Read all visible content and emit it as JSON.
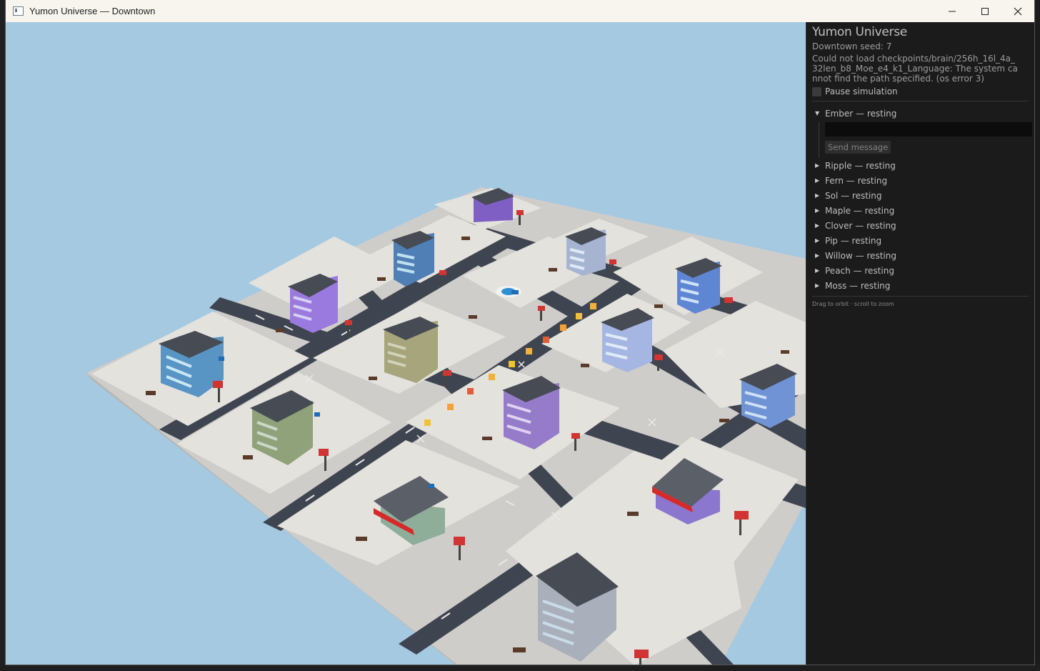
{
  "window": {
    "title": "Yumon Universe — Downtown",
    "controls": {
      "minimize": "—",
      "maximize": "☐",
      "close": "✕"
    }
  },
  "panel": {
    "title": "Yumon Universe",
    "seed": "Downtown seed: 7",
    "error": "Could not load checkpoints/brain/256h_16l_4a_32len_b8_Moe_e4_k1_Language: The system cannot find the path specified. (os error 3)",
    "pause_label": "Pause simulation",
    "pause_checked": false,
    "expanded_agent": {
      "label": "Ember — resting",
      "message_value": "",
      "send_label": "Send message"
    },
    "agents": [
      {
        "label": "Ripple — resting"
      },
      {
        "label": "Fern — resting"
      },
      {
        "label": "Sol — resting"
      },
      {
        "label": "Maple — resting"
      },
      {
        "label": "Clover — resting"
      },
      {
        "label": "Pip — resting"
      },
      {
        "label": "Willow — resting"
      },
      {
        "label": "Peach — resting"
      },
      {
        "label": "Moss — resting"
      }
    ],
    "hint": "Drag to orbit · scroll to zoom"
  },
  "scene": {
    "sky_color": "#a6c9e2",
    "ground_color": "#cfcdc9",
    "road_color": "#3f4550",
    "roof_color": "#474b54"
  }
}
